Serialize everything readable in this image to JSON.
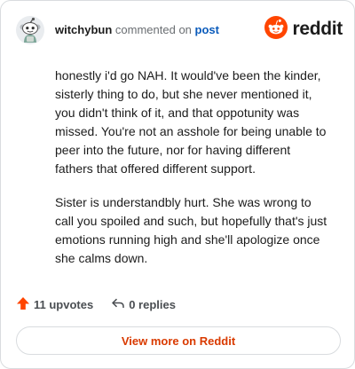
{
  "header": {
    "username": "witchybun",
    "commented_text": "commented on",
    "post_link": "post",
    "brand": "reddit",
    "avatar_icon": "snoo-avatar-icon",
    "brand_icon": "reddit-logo-icon"
  },
  "comment": {
    "paragraphs": [
      "honestly i'd go NAH. It would've been the kinder, sisterly thing to do, but she never mentioned it, you didn't think of it, and that oppotunity was missed. You're not an asshole for being unable to peer into the future, nor for having different fathers that offered different support.",
      "Sister is understandbly hurt. She was wrong to call you spoiled and such, but hopefully that's just emotions running high and she'll apologize once she calms down."
    ]
  },
  "actions": {
    "upvotes": "11 upvotes",
    "replies": "0 replies",
    "upvote_icon": "upvote-arrow-icon",
    "reply_icon": "reply-icon"
  },
  "footer": {
    "view_more": "View more on Reddit"
  },
  "colors": {
    "brand_orange": "#ff4500",
    "link_blue": "#0b5bbb",
    "upvote_red": "#ff4500",
    "view_more_text": "#d93a00"
  }
}
